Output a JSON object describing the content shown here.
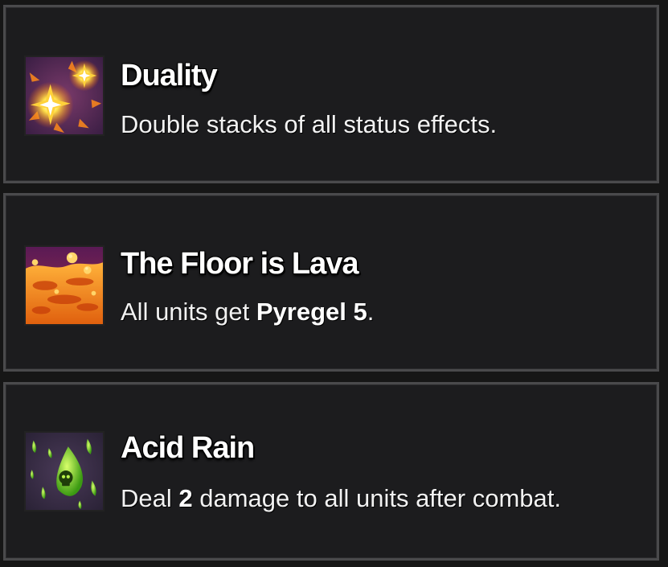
{
  "cards": [
    {
      "title": "Duality",
      "icon": "explosion-sparks-icon",
      "desc_parts": [
        "Double stacks of all status effects."
      ]
    },
    {
      "title": "The Floor is Lava",
      "icon": "lava-floor-icon",
      "desc_before": "All units get ",
      "desc_bold": "Pyregel 5",
      "desc_after": "."
    },
    {
      "title": "Acid Rain",
      "icon": "acid-drops-skull-icon",
      "desc_before": "Deal ",
      "desc_bold": "2",
      "desc_after": " damage to all units after combat."
    }
  ],
  "colors": {
    "card_bg": "#1c1c1e",
    "card_border": "#4a4a4c",
    "title_text": "#ffffff",
    "desc_text": "#f2f2f2"
  }
}
